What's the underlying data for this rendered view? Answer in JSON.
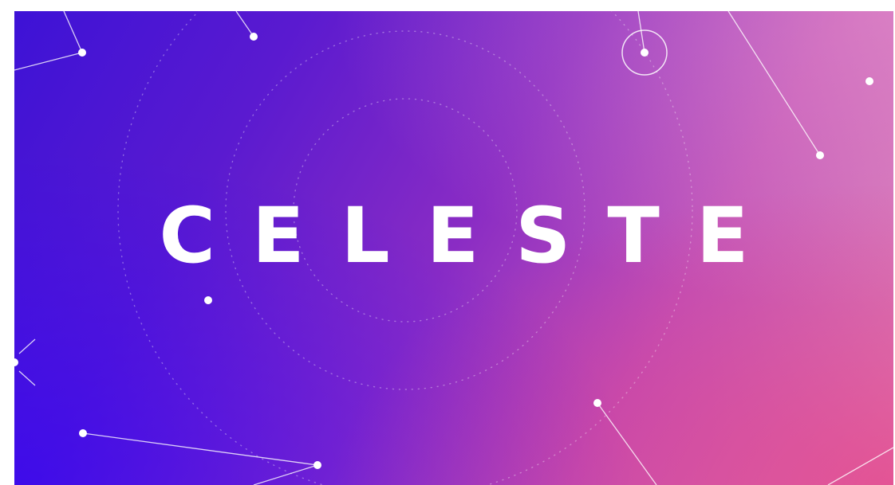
{
  "title_screen": {
    "logo_text": "CELESTE",
    "background": {
      "gradient_colors": [
        "#3d12d6",
        "#8a2cc4",
        "#c153b8",
        "#e08ab8"
      ],
      "accent_pink": "#e6287a",
      "accent_blue": "#2800ff"
    },
    "decorations": [
      "constellation-lines",
      "star-dots",
      "dotted-orbit-rings",
      "ringed-star"
    ]
  }
}
